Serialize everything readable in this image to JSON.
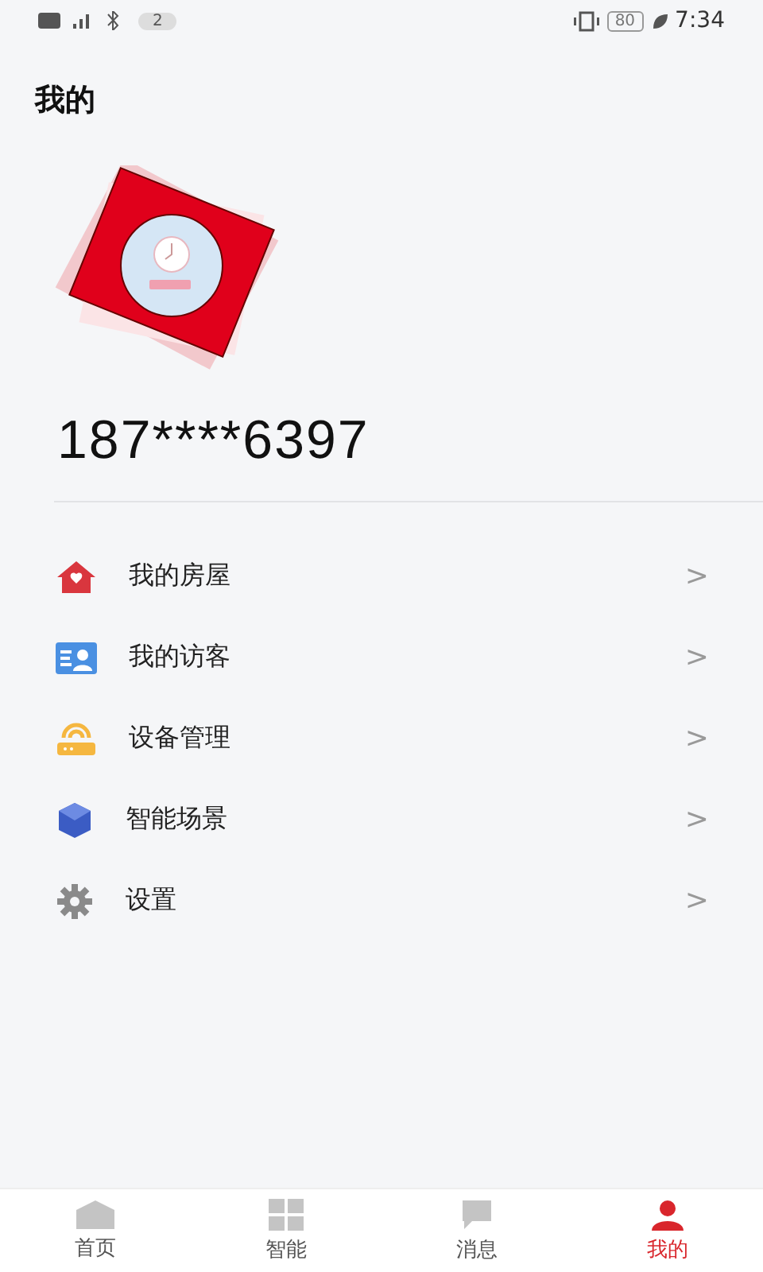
{
  "status_bar": {
    "notification_count": "2",
    "battery": "80",
    "time": "7:34"
  },
  "page_title": "我的",
  "phone": "187****6397",
  "menu": [
    {
      "kind": "house",
      "label": "我的房屋",
      "chevron": ">"
    },
    {
      "kind": "visitor",
      "label": "我的访客",
      "chevron": ">"
    },
    {
      "kind": "router",
      "label": "设备管理",
      "chevron": ">"
    },
    {
      "kind": "cube",
      "label": "智能场景",
      "chevron": ">"
    },
    {
      "kind": "gear",
      "label": "设置",
      "chevron": ">"
    }
  ],
  "tabs": [
    {
      "kind": "home",
      "label": "首页",
      "selected": false
    },
    {
      "kind": "grid",
      "label": "智能",
      "selected": false
    },
    {
      "kind": "message",
      "label": "消息",
      "selected": false
    },
    {
      "kind": "profile",
      "label": "我的",
      "selected": true
    }
  ]
}
